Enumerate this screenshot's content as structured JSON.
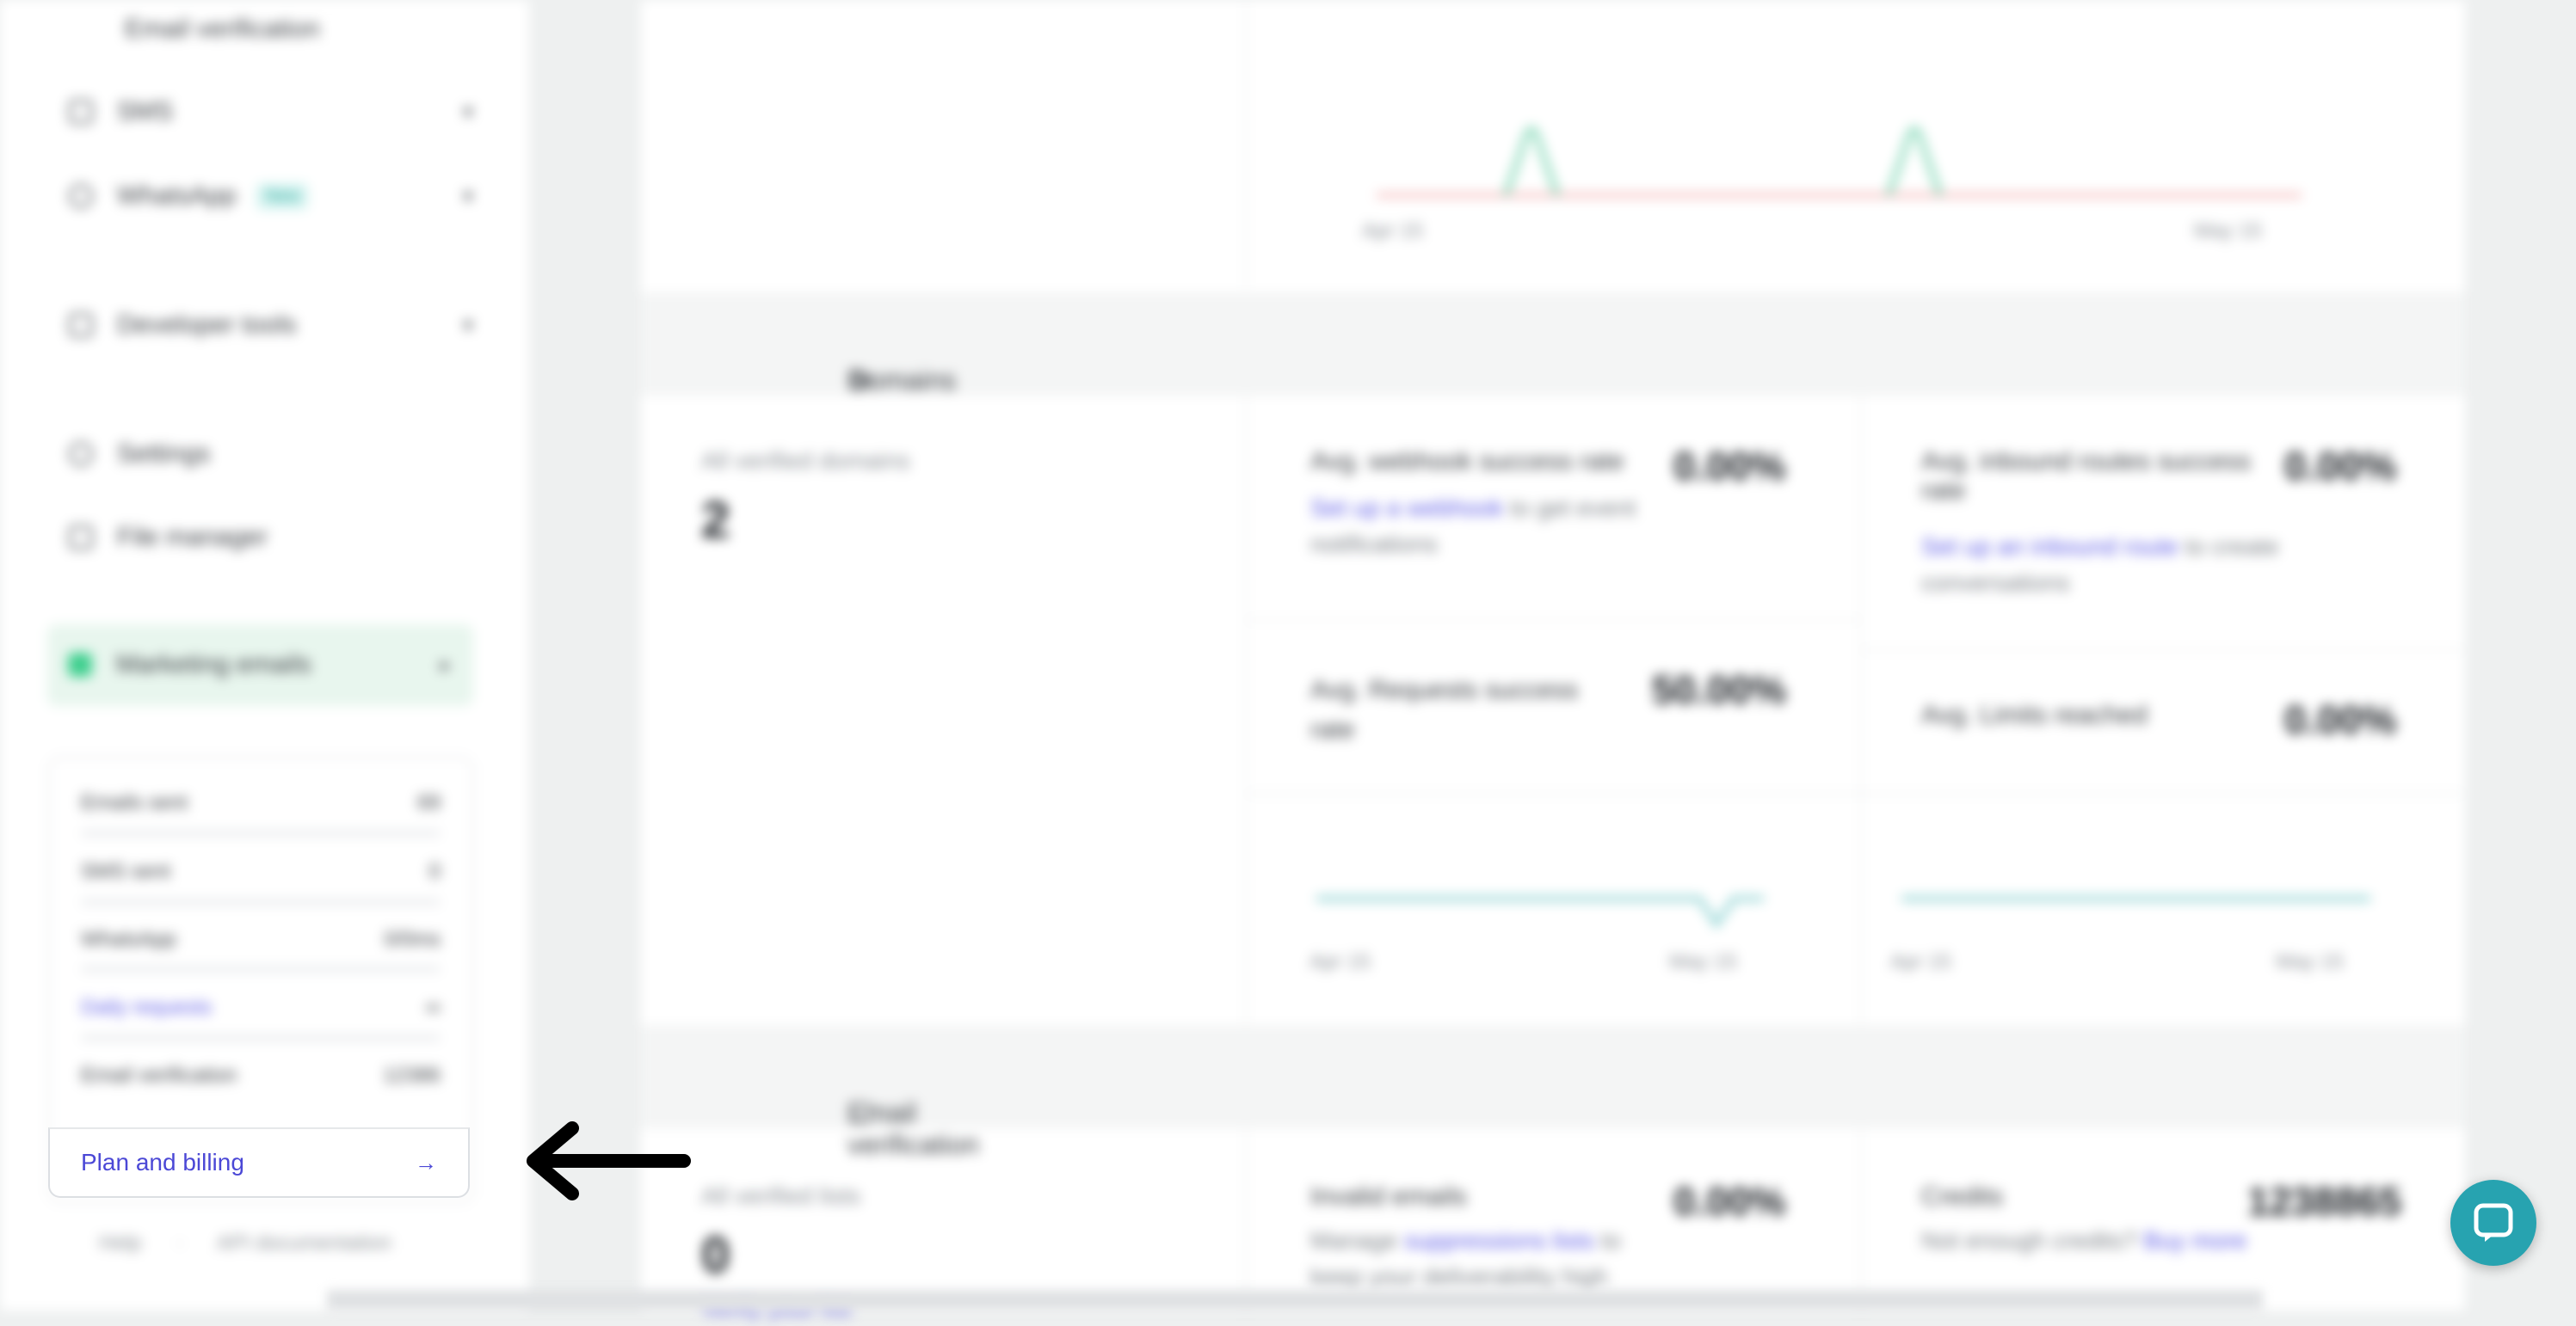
{
  "sidebar": {
    "items": [
      {
        "label": "Email verification",
        "icon": "check-icon"
      },
      {
        "label": "SMS",
        "icon": "phone-icon"
      },
      {
        "label": "WhatsApp",
        "badge": "New",
        "icon": "whatsapp-icon"
      },
      {
        "label": "Developer tools",
        "icon": "code-icon"
      },
      {
        "label": "Settings",
        "icon": "gear-icon"
      },
      {
        "label": "File manager",
        "icon": "folder-icon"
      },
      {
        "label": "Marketing emails",
        "icon": "flag-icon"
      }
    ],
    "usage": [
      {
        "label": "Emails sent",
        "value": "69"
      },
      {
        "label": "SMS sent",
        "value": "0"
      },
      {
        "label": "WhatsApp",
        "value": "0/0ms"
      },
      {
        "label": "Daily requests",
        "value": "∞"
      },
      {
        "label": "Email verification",
        "value": "12386"
      }
    ],
    "plan_billing_label": "Plan and billing",
    "footer": {
      "help": "Help",
      "api_docs": "API documentation"
    }
  },
  "main": {
    "top_chart_ticks": {
      "start": "Apr 15",
      "end": "May 15"
    },
    "domains": {
      "title": "Domains",
      "verified_label": "All verified domains",
      "verified_value": "2",
      "webhook": {
        "label": "Avg. webhook success rate",
        "value": "0.00%",
        "link": "Set up a webhook",
        "rest": "to get event notifications"
      },
      "inbound": {
        "label": "Avg. inbound routes success rate",
        "value": "0.00%",
        "link": "Set up an inbound route",
        "rest": "to create conversations"
      },
      "requests": {
        "label": "Avg. Requests success rate",
        "value": "50.00%"
      },
      "limits": {
        "label": "Avg. Limits reached",
        "value": "0.00%"
      },
      "ticks_left": {
        "start": "Apr 15",
        "end": "May 15"
      },
      "ticks_right": {
        "start": "Apr 15",
        "end": "May 15"
      }
    },
    "email_verification": {
      "title": "Email verification",
      "verified_lists_label": "All verified lists",
      "verified_lists_value": "0",
      "verify_link": "Verify your list",
      "invalid": {
        "label": "Invalid emails",
        "value": "0.00%",
        "pre": "Manage",
        "link": "suppressions lists",
        "rest": "to keep your deliverability high"
      },
      "credits": {
        "label": "Credits",
        "value": "1238865",
        "pre": "Not enough credits?",
        "link": "Buy more"
      }
    }
  },
  "colors": {
    "accent": "#4b48d6",
    "chat": "#27a3b0",
    "green": "#3ecf8e"
  }
}
